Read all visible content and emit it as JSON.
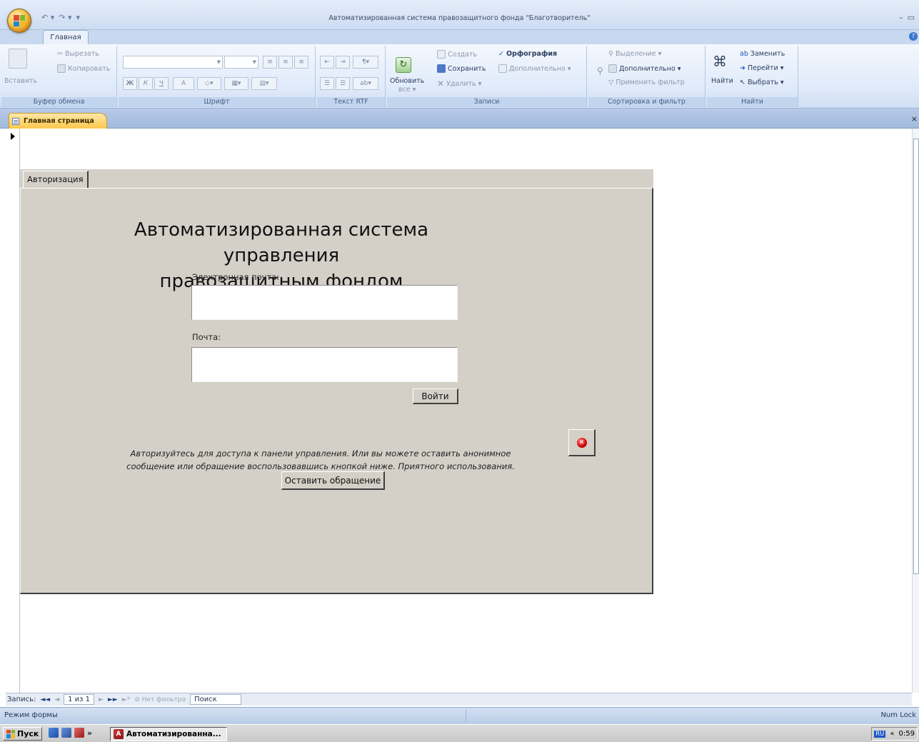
{
  "window": {
    "title": "Автоматизированная система правозащитного фонда \"Благотворитель\"",
    "qat_undo": "↶ ▾",
    "qat_redo": "↷ ▾",
    "qat_customize": "▾",
    "minimize": "–",
    "restore": "▭"
  },
  "ribbon": {
    "tab_home": "Главная",
    "clipboard": {
      "paste": "Вставить",
      "cut": "Вырезать",
      "copy": "Копировать",
      "caption": "Буфер обмена"
    },
    "font": {
      "bold": "Ж",
      "italic": "К",
      "underline": "Ч",
      "font_color": "A",
      "caption": "Шрифт"
    },
    "rtf": {
      "caption": "Текст RTF"
    },
    "records": {
      "refresh": "Обновить",
      "refresh_sub": "все ▾",
      "new": "Создать",
      "save": "Сохранить",
      "delete": "Удалить ▾",
      "spelling": "Орфография",
      "more": "Дополнительно ▾",
      "caption": "Записи"
    },
    "sort_filter": {
      "selection": "Выделение ▾",
      "advanced": "Дополнительно ▾",
      "toggle": "Применить фильтр",
      "caption": "Сортировка и фильтр"
    },
    "find": {
      "find": "Найти",
      "replace": "Заменить",
      "goto": "Перейти ▾",
      "select": "Выбрать ▾",
      "caption": "Найти"
    }
  },
  "doc_tab": {
    "label": "Главная страница",
    "close": "×"
  },
  "form": {
    "tab_label": "Авторизация",
    "title_line1": "Автоматизированная система управления",
    "title_line2": "правозащитным фондом «Благотворитель»",
    "email_label": "Электронная почта:",
    "email_value": "",
    "password_label": "Почта:",
    "password_value": "",
    "login_button": "Войти",
    "hint_line1": "Авторизуйтесь для доступа к панели управления. Или вы можете оставить анонимное",
    "hint_line2": "сообщение или обращение воспользовавшись кнопкой ниже. Приятного использования.",
    "appeal_button": "Оставить обращение"
  },
  "nav": {
    "record_label": "Запись:",
    "first": "◄◄",
    "prev": "◄",
    "position": "1 из 1",
    "next": "►",
    "last": "►►",
    "new": "►*",
    "filter_status": "Нет фильтра",
    "search": "Поиск"
  },
  "status": {
    "mode": "Режим формы",
    "numlock": "Num Lock"
  },
  "taskbar": {
    "start": "Пуск",
    "more": "»",
    "task": "Автоматизированна...",
    "lang": "RU",
    "tray_arrow": "«",
    "clock": "0:59"
  },
  "colors": {
    "form_bg": "#d4d0c8",
    "ribbon_bg": "#dfeafa",
    "doc_tab": "#fbc84c",
    "close_red": "#d10000"
  }
}
